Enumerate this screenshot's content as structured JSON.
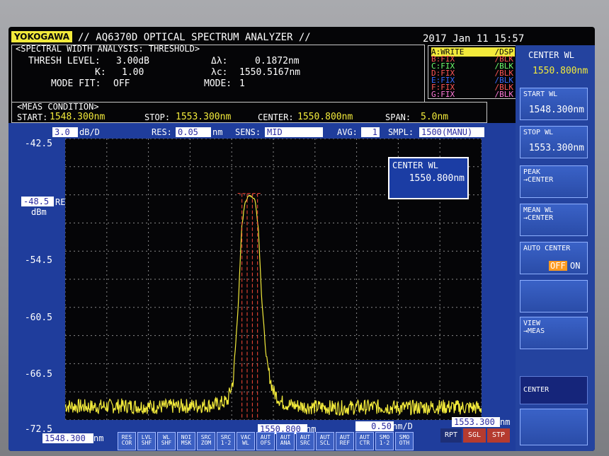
{
  "instrument": {
    "brand": "YOKOGAWA",
    "title": "// AQ6370D OPTICAL SPECTRUM ANALYZER //",
    "datetime": "2017 Jan 11 15:57"
  },
  "analysis": {
    "header": "<SPECTRAL WIDTH ANALYSIS: THRESHOLD>",
    "thresh_label": "THRESH LEVEL:",
    "thresh_value": "3.00dB",
    "k_label": "K:",
    "k_value": "1.00",
    "modefit_label": "MODE FIT:",
    "modefit_value": "OFF",
    "dlambda_label": "Δλ:",
    "dlambda_value": "0.1872nm",
    "lambdac_label": "λc:",
    "lambdac_value": "1550.5167nm",
    "mode_label": "MODE:",
    "mode_value": "1"
  },
  "traces": [
    {
      "name": "A:WRITE",
      "mode": "/DSP"
    },
    {
      "name": "B:FIX",
      "mode": "/BLK"
    },
    {
      "name": "C:FIX",
      "mode": "/BLK"
    },
    {
      "name": "D:FIX",
      "mode": "/BLK"
    },
    {
      "name": "E:FIX",
      "mode": "/BLK"
    },
    {
      "name": "F:FIX",
      "mode": "/BLK"
    },
    {
      "name": "G:FIX",
      "mode": "/BLK"
    }
  ],
  "meas": {
    "header": "<MEAS CONDITION>",
    "start_label": "START:",
    "start_value": "1548.300nm",
    "stop_label": "STOP:",
    "stop_value": "1553.300nm",
    "center_label": "CENTER:",
    "center_value": "1550.800nm",
    "span_label": "SPAN:",
    "span_value": "5.0nm"
  },
  "settings": {
    "scale_value": "3.0",
    "scale_unit": "dB/D",
    "res_label": "RES:",
    "res_value": "0.05",
    "res_unit": "nm",
    "sens_label": "SENS:",
    "sens_value": "MID",
    "avg_label": "AVG:",
    "avg_value": "1",
    "smpl_label": "SMPL:",
    "smpl_value": "1500(MANU)"
  },
  "yaxis": {
    "ref_value": "-48.5",
    "ref_label": "REF",
    "unit": "dBm",
    "ticks": [
      "-42.5",
      "-54.5",
      "-60.5",
      "-66.5",
      "-72.5"
    ]
  },
  "xaxis": {
    "start": "1548.300",
    "start_unit": "nm",
    "center": "1550.800",
    "center_unit": "nm",
    "span_per_div": "0.50",
    "span_unit": "nm/D",
    "stop": "1553.300",
    "stop_unit": "nm"
  },
  "popup": {
    "label": "CENTER WL",
    "value": "1550.800nm"
  },
  "softkeys": {
    "center_wl_label": "CENTER WL",
    "center_wl_value": "1550.800nm",
    "start_wl_label": "START WL",
    "start_wl_value": "1548.300nm",
    "stop_wl_label": "STOP WL",
    "stop_wl_value": "1553.300nm",
    "peak_center_l1": "PEAK",
    "peak_center_l2": "→CENTER",
    "mean_center_l1": "MEAN WL",
    "mean_center_l2": "→CENTER",
    "auto_center_label": "AUTO CENTER",
    "auto_off": "OFF",
    "auto_on": "ON",
    "view_meas_l1": "VIEW",
    "view_meas_l2": "→MEAS",
    "center": "CENTER"
  },
  "bottom_buttons": [
    [
      "RES",
      "COR"
    ],
    [
      "LVL",
      "SHF"
    ],
    [
      "WL",
      "SHF"
    ],
    [
      "NOI",
      "MSK"
    ],
    [
      "SRC",
      "ZOM"
    ],
    [
      "SRC",
      "1·2"
    ],
    [
      "VAC",
      "WL"
    ],
    [
      "AUT",
      "OFS"
    ],
    [
      "AUT",
      "ANA"
    ],
    [
      "AUT",
      "SRC"
    ],
    [
      "AUT",
      "SCL"
    ],
    [
      "AUT",
      "REF"
    ],
    [
      "AUT",
      "CTR"
    ],
    [
      "SMO",
      "1·2"
    ],
    [
      "SMO",
      "OTH"
    ]
  ],
  "sweep_buttons": {
    "rpt": "RPT",
    "sgl": "SGL",
    "stp": "STP"
  },
  "chart_data": {
    "type": "line",
    "xlim": [
      1548.3,
      1553.3
    ],
    "ylim": [
      -72.5,
      -42.5
    ],
    "grid": true,
    "x": [
      1548.3,
      1548.6,
      1549.0,
      1549.4,
      1549.8,
      1550.1,
      1550.25,
      1550.32,
      1550.38,
      1550.42,
      1550.46,
      1550.52,
      1550.58,
      1550.62,
      1550.66,
      1550.72,
      1550.8,
      1550.9,
      1551.0,
      1551.2,
      1551.6,
      1552.0,
      1552.4,
      1552.8,
      1553.3
    ],
    "values": [
      -71.0,
      -71.1,
      -71.0,
      -71.1,
      -71.0,
      -70.9,
      -70.5,
      -68.2,
      -60.0,
      -52.0,
      -49.2,
      -48.5,
      -49.0,
      -52.0,
      -59.5,
      -66.5,
      -69.5,
      -70.6,
      -70.9,
      -71.1,
      -71.2,
      -71.1,
      -71.2,
      -71.1,
      -71.2
    ],
    "lambda_c": 1550.5167,
    "delta_lambda": 0.1872
  }
}
